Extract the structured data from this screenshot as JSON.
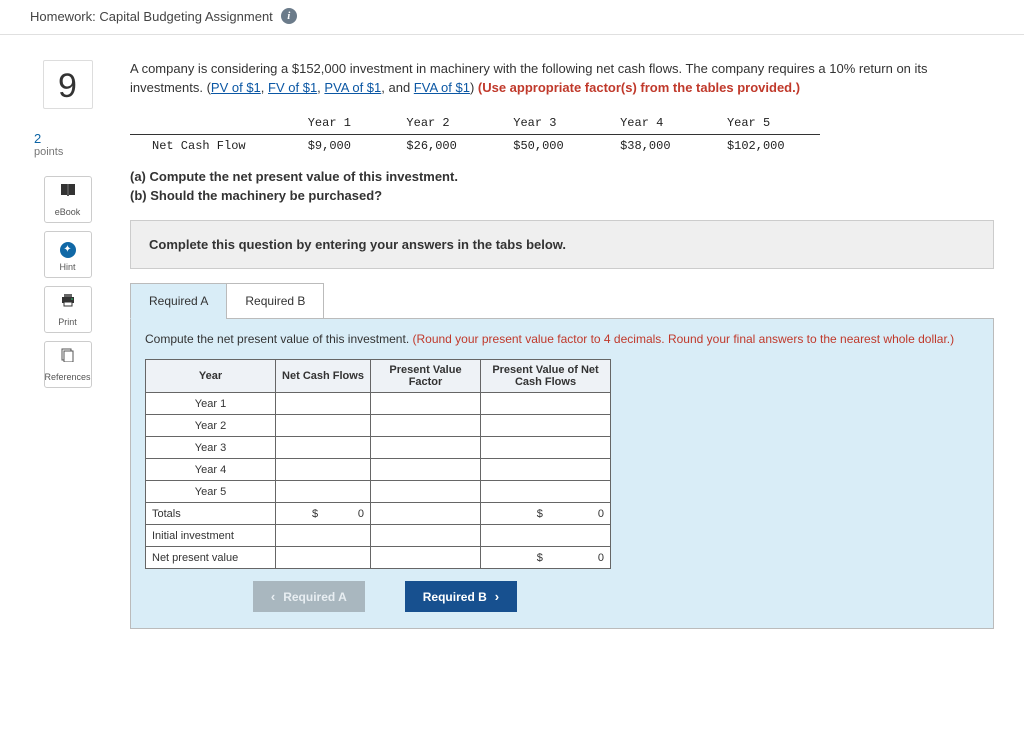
{
  "header": {
    "title": "Homework: Capital Budgeting Assignment"
  },
  "question": {
    "number": "9",
    "points_value": "2",
    "points_label": "points"
  },
  "tools": {
    "ebook": "eBook",
    "hint": "Hint",
    "print": "Print",
    "references": "References"
  },
  "problem": {
    "intro_a": "A company is considering a $152,000 investment in machinery with the following net cash flows. The company requires a 10% return on its investments. (",
    "link_pv": "PV of $1",
    "link_fv": "FV of $1",
    "link_pva": "PVA of $1",
    "link_fva": "FVA of $1",
    "sep": ", ",
    "and": ", and ",
    "close_paren": ") ",
    "red_note": "(Use appropriate factor(s) from the tables provided.)"
  },
  "cashflow": {
    "row_label": "Net Cash Flow",
    "headers": [
      "Year 1",
      "Year 2",
      "Year 3",
      "Year 4",
      "Year 5"
    ],
    "values": [
      "$9,000",
      "$26,000",
      "$50,000",
      "$38,000",
      "$102,000"
    ]
  },
  "parts": {
    "a": "(a) Compute the net present value of this investment.",
    "b": "(b) Should the machinery be purchased?"
  },
  "instruction_box": "Complete this question by entering your answers in the tabs below.",
  "tabs": {
    "a": "Required A",
    "b": "Required B"
  },
  "tab_panel": {
    "instr_black": "Compute the net present value of this investment. ",
    "instr_red": "(Round your present value factor to 4 decimals. Round your final answers to the nearest whole dollar.)"
  },
  "answer_table": {
    "headers": {
      "year": "Year",
      "ncf": "Net Cash Flows",
      "pvf": "Present Value Factor",
      "pvn": "Present Value of Net Cash Flows"
    },
    "rows": [
      "Year 1",
      "Year 2",
      "Year 3",
      "Year 4",
      "Year 5"
    ],
    "totals_label": "Totals",
    "initial_label": "Initial investment",
    "npv_label": "Net present value",
    "totals_ncf": "$             0",
    "totals_pvn": "$                  0",
    "npv_pvn": "$                  0"
  },
  "nav": {
    "prev": "Required A",
    "next": "Required B"
  }
}
